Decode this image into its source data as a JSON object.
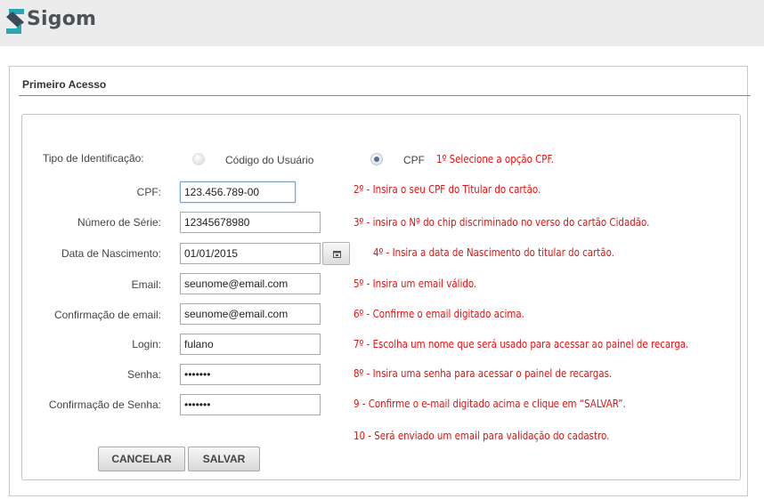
{
  "app": {
    "logo_text": "Sigom",
    "logo_icon": "sigom-s-icon"
  },
  "panel": {
    "title": "Primeiro Acesso"
  },
  "form": {
    "id_type": {
      "label": "Tipo de Identificação:",
      "options": [
        {
          "label": "Código do Usuário",
          "selected": false
        },
        {
          "label": "CPF",
          "selected": true
        }
      ]
    },
    "fields": {
      "cpf": {
        "label": "CPF:",
        "value": "123.456.789-00"
      },
      "serial": {
        "label": "Número de Série:",
        "value": "12345678980"
      },
      "birth": {
        "label": "Data de Nascimento:",
        "value": "01/01/2015"
      },
      "email": {
        "label": "Email:",
        "value": "seunome@email.com"
      },
      "email_confirm": {
        "label": "Confirmação de email:",
        "value": "seunome@email.com"
      },
      "login": {
        "label": "Login:",
        "value": "fulano"
      },
      "password": {
        "label": "Senha:",
        "value": "1234567"
      },
      "password_confirm": {
        "label": "Confirmação de Senha:",
        "value": "1234567"
      }
    },
    "buttons": {
      "cancel": "CANCELAR",
      "save": "SALVAR"
    }
  },
  "notes": [
    "1º Selecione a opção CPF.",
    "2º - Insira o seu CPF do Titular do cartão.",
    "3º - insira o Nº do chip discriminado no verso do cartão Cidadão.",
    "4º - Insira a data de Nascimento do titular do cartão.",
    "5º - Insira um email válido.",
    "6º - Confirme o email digitado acima.",
    "7º - Escolha um nome que será usado para acessar ao painel de recarga.",
    "8º - Insira uma senha para acessar o painel de recargas.",
    "9  - Confirme o e-mail digitado acima e clique em “SALVAR”.",
    "10 -  Será enviado um email para validação do cadastro."
  ],
  "colors": {
    "note": "#e31212",
    "logo_accent": "#2aa6b3",
    "logo_text": "#4d5257"
  }
}
